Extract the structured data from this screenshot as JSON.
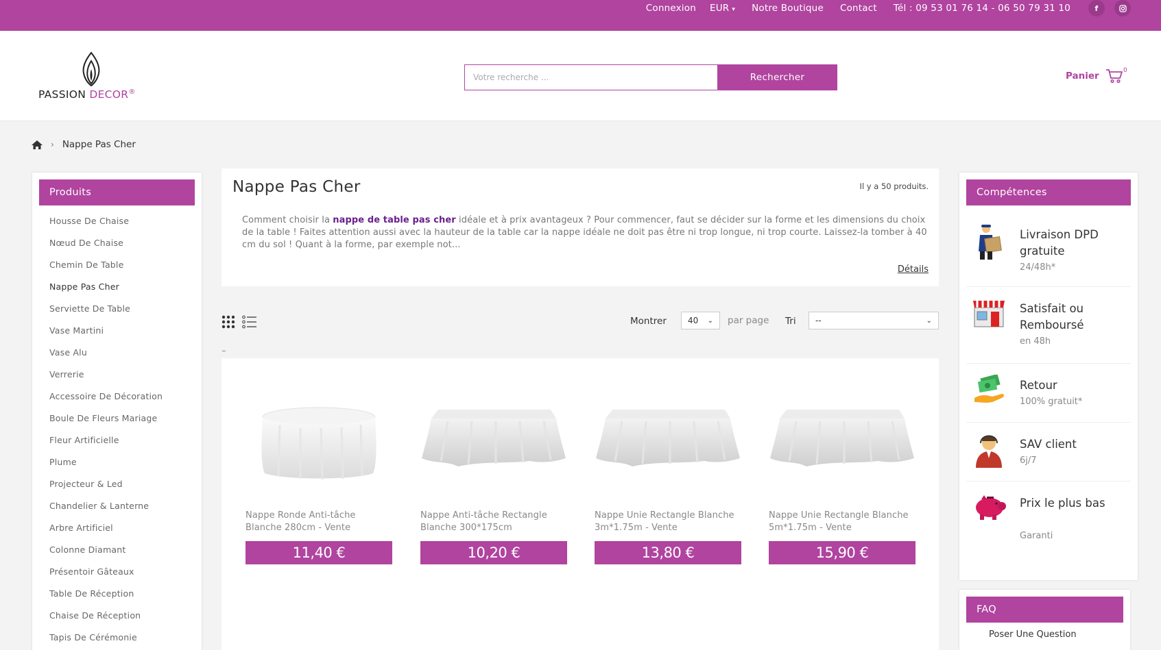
{
  "topbar": {
    "login": "Connexion",
    "currency": "EUR",
    "shop": "Notre Boutique",
    "contact": "Contact",
    "phone": "Tél : 09 53 01 76 14 - 06 50 79 31 10",
    "facebook_icon": "f",
    "instagram_icon": "instagram-icon"
  },
  "header": {
    "logo_text_a": "PASSION",
    "logo_text_b": "DECOR",
    "logo_reg": "®",
    "search_placeholder": "Votre recherche ...",
    "search_button": "Rechercher",
    "cart_label": "Panier",
    "cart_count": "0"
  },
  "breadcrumb": {
    "sep": "›",
    "current": "Nappe Pas Cher"
  },
  "sidebar": {
    "title": "Produits",
    "items": [
      "Housse De Chaise",
      "Nœud De Chaise",
      "Chemin De Table",
      "Nappe Pas Cher",
      "Serviette De Table",
      "Vase Martini",
      "Vase Alu",
      "Verrerie",
      "Accessoire De Décoration",
      "Boule De Fleurs Mariage",
      "Fleur Artificielle",
      "Plume",
      "Projecteur & Led",
      "Chandelier & Lanterne",
      "Arbre Artificiel",
      "Colonne Diamant",
      "Présentoir Gâteaux",
      "Table De Réception",
      "Chaise De Réception",
      "Tapis De Cérémonie"
    ],
    "active_index": 3
  },
  "category": {
    "title": "Nappe Pas Cher",
    "count": "Il y a 50 produits.",
    "desc_pre": "Comment choisir la ",
    "desc_bold": "nappe de table pas cher",
    "desc_post": " idéale et à prix avantageux ? Pour commencer, faut se décider sur la forme et les dimensions du choix de la table ! Faites attention aussi avec la hauteur de la table car la nappe idéale ne doit pas être ni trop longue, ni trop courte. Laissez-la tomber à 40 cm du sol ! Quant à la forme, par exemple not...",
    "details": "Détails"
  },
  "toolbar": {
    "show_label": "Montrer",
    "per_page_value": "40",
    "per_page_label": "par page",
    "sort_label": "Tri",
    "sort_value": "--"
  },
  "products": [
    {
      "name": "Nappe Ronde Anti-tâche Blanche 280cm - Vente",
      "price": "11,40 €",
      "shape": "round"
    },
    {
      "name": "Nappe Anti-tâche Rectangle Blanche 300*175cm",
      "price": "10,20 €",
      "shape": "rect"
    },
    {
      "name": "Nappe Unie Rectangle Blanche 3m*1.75m - Vente",
      "price": "13,80 €",
      "shape": "rect"
    },
    {
      "name": "Nappe Unie Rectangle Blanche 5m*1.75m - Vente",
      "price": "15,90 €",
      "shape": "rect"
    }
  ],
  "skills": {
    "title": "Compétences",
    "items": [
      {
        "title": "Livraison DPD gratuite",
        "sub": "24/48h*",
        "icon": "delivery-man-icon"
      },
      {
        "title": "Satisfait ou Remboursé",
        "sub": "en 48h",
        "icon": "shop-front-icon"
      },
      {
        "title": "Retour",
        "sub": "100% gratuit*",
        "icon": "money-hand-icon"
      },
      {
        "title": "SAV client",
        "sub": "6j/7",
        "icon": "support-agent-icon"
      },
      {
        "title": "Prix le plus bas",
        "sub": "Garanti",
        "icon": "piggy-bank-icon"
      }
    ]
  },
  "faq": {
    "title": "FAQ",
    "question": "Poser Une Question"
  },
  "colors": {
    "brand": "#b0449f",
    "link_bold": "#6a1f8e"
  }
}
